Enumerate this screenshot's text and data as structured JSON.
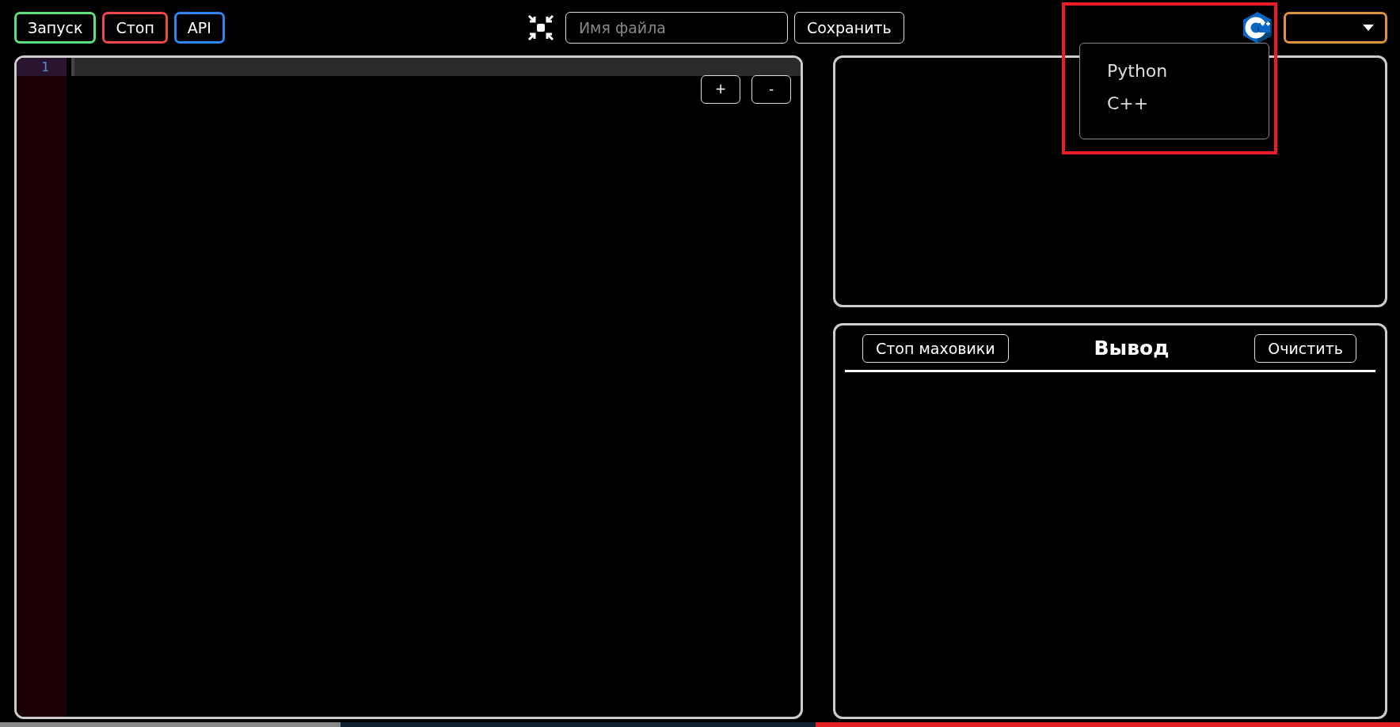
{
  "toolbar": {
    "buttons": [
      {
        "label": "Запуск",
        "color": "#5ee07a"
      },
      {
        "label": "Стоп",
        "color": "#f04848"
      },
      {
        "label": "API",
        "color": "#2f86f0"
      }
    ],
    "filename": {
      "placeholder": "Имя файла"
    },
    "save_button": "Сохранить"
  },
  "language_menu": {
    "expanded": true,
    "items": [
      {
        "label": "Python"
      },
      {
        "label": "C++"
      }
    ]
  },
  "annotation_box": true,
  "editor": {
    "line_numbers": [
      "1"
    ],
    "zoom_buttons": [
      "+",
      "-"
    ]
  },
  "output": {
    "title": "Вывод",
    "buttons": [
      "Стоп маховики",
      "Очистить"
    ]
  }
}
